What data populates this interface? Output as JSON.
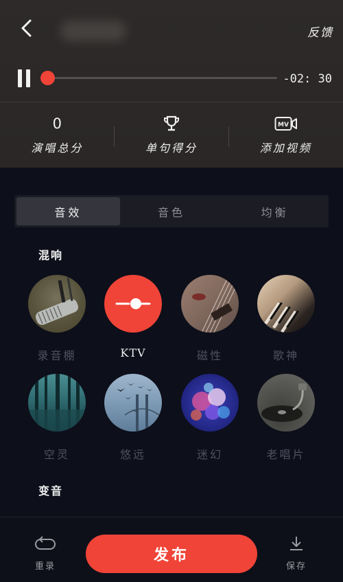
{
  "header": {
    "feedback_label": "反馈"
  },
  "player": {
    "progress": 0.02,
    "remaining_time": "-02: 30"
  },
  "stats": {
    "total_score_value": "0",
    "total_score_label": "演唱总分",
    "sentence_score_label": "单句得分",
    "add_video_label": "添加视频"
  },
  "tabs": [
    {
      "label": "音效",
      "active": true
    },
    {
      "label": "音色",
      "active": false
    },
    {
      "label": "均衡",
      "active": false
    }
  ],
  "reverb": {
    "section_title": "混响",
    "items": [
      {
        "label": "录音棚",
        "selected": false,
        "icon": "microphone-image"
      },
      {
        "label": "KTV",
        "selected": true,
        "icon": "ktv-slider-icon"
      },
      {
        "label": "磁性",
        "selected": false,
        "icon": "guitar-image"
      },
      {
        "label": "歌神",
        "selected": false,
        "icon": "piano-image"
      },
      {
        "label": "空灵",
        "selected": false,
        "icon": "forest-image"
      },
      {
        "label": "悠远",
        "selected": false,
        "icon": "bridge-birds-image"
      },
      {
        "label": "迷幻",
        "selected": false,
        "icon": "bokeh-image"
      },
      {
        "label": "老唱片",
        "selected": false,
        "icon": "record-player-image"
      }
    ]
  },
  "voice_change": {
    "section_title": "变音"
  },
  "bottom_bar": {
    "retake_label": "重录",
    "publish_label": "发布",
    "save_label": "保存"
  },
  "colors": {
    "accent": "#f04438",
    "background": "#0d0f1a",
    "top_panel": "#2b2827"
  }
}
